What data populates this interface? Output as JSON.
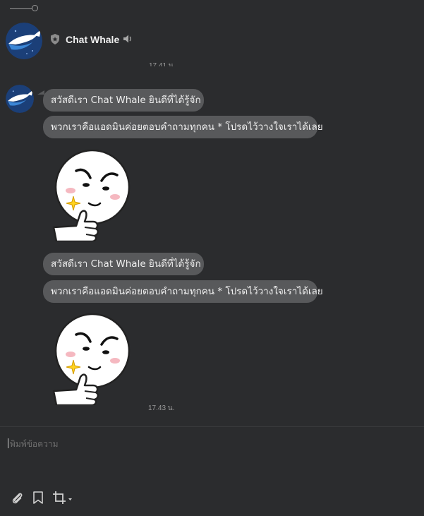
{
  "header": {
    "title": "Chat Whale",
    "avatar_icon": "whale-logo-icon",
    "badge_icon": "official-shield-icon",
    "sound_icon": "speaker-icon"
  },
  "messages": {
    "timestamp_top": "17.41 น.",
    "group1": [
      "สวัสดีเรา Chat Whale ยินดีที่ได้รู้จัก",
      "พวกเราคือแอดมินค่อยตอบคำถามทุกคน * โปรดไว้วางใจเราได้เลย"
    ],
    "group2": [
      "สวัสดีเรา Chat Whale ยินดีที่ได้รู้จัก",
      "พวกเราคือแอดมินค่อยตอบคำถามทุกคน * โปรดไว้วางใจเราได้เลย"
    ],
    "sticker_icon": "thumbs-up-sticker",
    "timestamp_bottom": "17.43 น."
  },
  "composer": {
    "placeholder": "พิมพ์ข้อความ",
    "tools": [
      "paperclip-icon",
      "bookmark-icon",
      "crop-icon"
    ]
  },
  "colors": {
    "background": "#2b2c2e",
    "bubble": "#58595b",
    "accent": "#1e6fbf"
  }
}
